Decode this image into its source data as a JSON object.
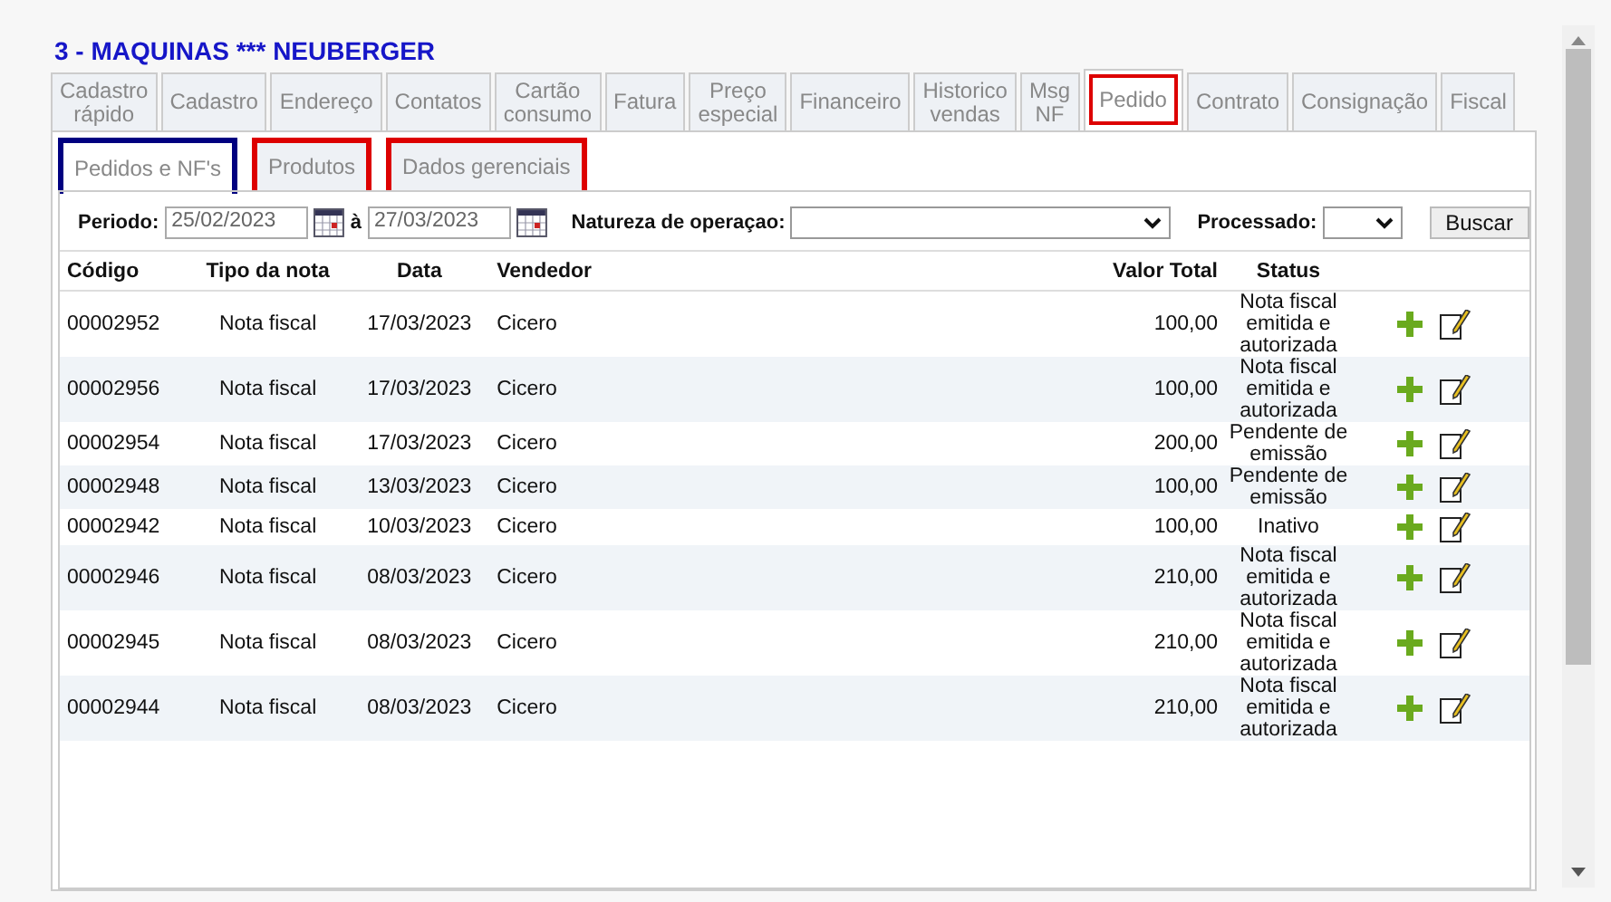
{
  "title": "3 - MAQUINAS *** NEUBERGER",
  "tabs": [
    {
      "label": "Cadastro rápido",
      "selected": false,
      "outlined": false
    },
    {
      "label": "Cadastro",
      "selected": false,
      "outlined": false
    },
    {
      "label": "Endereço",
      "selected": false,
      "outlined": false
    },
    {
      "label": "Contatos",
      "selected": false,
      "outlined": false
    },
    {
      "label": "Cartão consumo",
      "selected": false,
      "outlined": false
    },
    {
      "label": "Fatura",
      "selected": false,
      "outlined": false
    },
    {
      "label": "Preço especial",
      "selected": false,
      "outlined": false
    },
    {
      "label": "Financeiro",
      "selected": false,
      "outlined": false
    },
    {
      "label": "Historico vendas",
      "selected": false,
      "outlined": false
    },
    {
      "label": "Msg NF",
      "selected": false,
      "outlined": false
    },
    {
      "label": "Pedido",
      "selected": true,
      "outlined": true
    },
    {
      "label": "Contrato",
      "selected": false,
      "outlined": false
    },
    {
      "label": "Consignação",
      "selected": false,
      "outlined": false
    },
    {
      "label": "Fiscal",
      "selected": false,
      "outlined": false
    }
  ],
  "subtabs": [
    {
      "label": "Pedidos e NF's",
      "selected": true,
      "color": "#000080"
    },
    {
      "label": "Produtos",
      "selected": false,
      "color": "#dd0000"
    },
    {
      "label": "Dados gerenciais",
      "selected": false,
      "color": "#dd0000"
    }
  ],
  "filters": {
    "period_label": "Periodo:",
    "date_from": "25/02/2023",
    "between": "à",
    "date_to": "27/03/2023",
    "nature_label": "Natureza de operaçao:",
    "processed_label": "Processado:",
    "search_button": "Buscar"
  },
  "table": {
    "columns": [
      "Código",
      "Tipo da nota",
      "Data",
      "Vendedor",
      "Valor Total",
      "Status"
    ],
    "rows": [
      {
        "code": "00002952",
        "type": "Nota fiscal",
        "date": "17/03/2023",
        "seller": "Cicero",
        "total": "100,00",
        "status": "Nota fiscal emitida e autorizada"
      },
      {
        "code": "00002956",
        "type": "Nota fiscal",
        "date": "17/03/2023",
        "seller": "Cicero",
        "total": "100,00",
        "status": "Nota fiscal emitida e autorizada"
      },
      {
        "code": "00002954",
        "type": "Nota fiscal",
        "date": "17/03/2023",
        "seller": "Cicero",
        "total": "200,00",
        "status": "Pendente de emissão"
      },
      {
        "code": "00002948",
        "type": "Nota fiscal",
        "date": "13/03/2023",
        "seller": "Cicero",
        "total": "100,00",
        "status": "Pendente de emissão"
      },
      {
        "code": "00002942",
        "type": "Nota fiscal",
        "date": "10/03/2023",
        "seller": "Cicero",
        "total": "100,00",
        "status": "Inativo"
      },
      {
        "code": "00002946",
        "type": "Nota fiscal",
        "date": "08/03/2023",
        "seller": "Cicero",
        "total": "210,00",
        "status": "Nota fiscal emitida e autorizada"
      },
      {
        "code": "00002945",
        "type": "Nota fiscal",
        "date": "08/03/2023",
        "seller": "Cicero",
        "total": "210,00",
        "status": "Nota fiscal emitida e autorizada"
      },
      {
        "code": "00002944",
        "type": "Nota fiscal",
        "date": "08/03/2023",
        "seller": "Cicero",
        "total": "210,00",
        "status": "Nota fiscal emitida e autorizada"
      }
    ]
  }
}
